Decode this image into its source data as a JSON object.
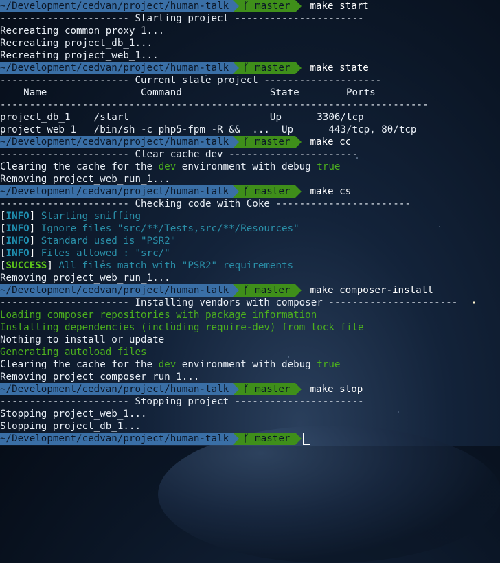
{
  "prompt": {
    "path": "~/Development/cedvan/project/human-talk",
    "branch_icon": "git-branch-icon",
    "branch": "master"
  },
  "blocks": [
    {
      "command": "make start",
      "lines": [
        {
          "text": "---------------------- Starting project ----------------------",
          "style": "plain"
        },
        {
          "text": "Recreating common_proxy_1...",
          "style": "plain"
        },
        {
          "text": "Recreating project_db_1...",
          "style": "plain"
        },
        {
          "text": "Recreating project_web_1...",
          "style": "plain"
        }
      ]
    },
    {
      "command": "make state",
      "lines": [
        {
          "text": "---------------------- Current state project --------------------",
          "style": "plain"
        },
        {
          "text": "    Name                Command               State        Ports",
          "style": "plain"
        },
        {
          "text": "-------------------------------------------------------------------------",
          "style": "plain"
        },
        {
          "text": "project_db_1    /start                        Up      3306/tcp",
          "style": "plain"
        },
        {
          "text": "project_web_1   /bin/sh -c php5-fpm -R &&  ...  Up      443/tcp, 80/tcp",
          "style": "plain"
        }
      ]
    },
    {
      "command": "make cc",
      "lines": [
        {
          "text": "---------------------- Clear cache dev ----------------------",
          "style": "plain"
        },
        {
          "parts": [
            {
              "text": "Clearing the cache for the ",
              "style": "plain"
            },
            {
              "text": "dev",
              "style": "green"
            },
            {
              "text": " environment with debug ",
              "style": "plain"
            },
            {
              "text": "true",
              "style": "green"
            }
          ]
        },
        {
          "text": "Removing project_web_run_1...",
          "style": "plain"
        }
      ]
    },
    {
      "command": "make cs",
      "lines": [
        {
          "text": "---------------------- Checking code with Coke -----------------------",
          "style": "plain"
        },
        {
          "tag": "INFO",
          "tag_style": "tag",
          "text": " Starting sniffing",
          "style": "cyan"
        },
        {
          "tag": "INFO",
          "tag_style": "tag",
          "text": " Ignore files \"src/**/Tests,src/**/Resources\"",
          "style": "cyan"
        },
        {
          "tag": "INFO",
          "tag_style": "tag",
          "text": " Standard used is \"PSR2\"",
          "style": "cyan"
        },
        {
          "tag": "INFO",
          "tag_style": "tag",
          "text": " Files allowed : \"src/\"",
          "style": "cyan"
        },
        {
          "tag": "SUCCESS",
          "tag_style": "tag-success",
          "text": " All files match with \"PSR2\" requirements",
          "style": "cyan"
        },
        {
          "text": "Removing project_web_run_1...",
          "style": "plain"
        }
      ]
    },
    {
      "command": "make composer-install",
      "lines": [
        {
          "text": "---------------------- Installing vendors with composer ----------------------",
          "style": "plain"
        },
        {
          "text": "Loading composer repositories with package information",
          "style": "green"
        },
        {
          "text": "Installing dependencies (including require-dev) from lock file",
          "style": "green"
        },
        {
          "text": "Nothing to install or update",
          "style": "plain"
        },
        {
          "text": "Generating autoload files",
          "style": "green"
        },
        {
          "parts": [
            {
              "text": "Clearing the cache for the ",
              "style": "plain"
            },
            {
              "text": "dev",
              "style": "green"
            },
            {
              "text": " environment with debug ",
              "style": "plain"
            },
            {
              "text": "true",
              "style": "green"
            }
          ]
        },
        {
          "text": "Removing project_composer_run_1...",
          "style": "plain"
        }
      ]
    },
    {
      "command": "make stop",
      "lines": [
        {
          "text": "---------------------- Stopping project ----------------------",
          "style": "plain"
        },
        {
          "text": "Stopping project_web_1...",
          "style": "plain"
        },
        {
          "text": "Stopping project_db_1...",
          "style": "plain"
        }
      ]
    }
  ],
  "final_prompt": {
    "command": "",
    "cursor_icon": "block-cursor-icon"
  },
  "colors": {
    "path_bg": "#3a6fa6",
    "branch_bg": "#3f8f1a",
    "green_text": "#4caf1e",
    "cyan_text": "#2a8fa8"
  }
}
